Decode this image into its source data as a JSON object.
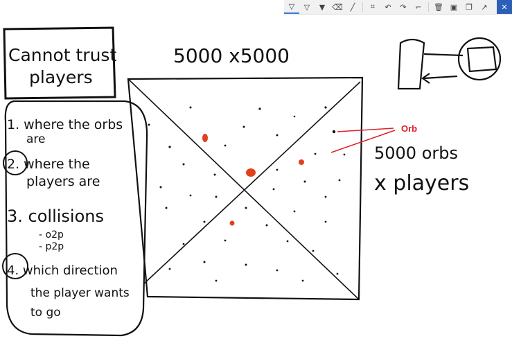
{
  "toolbar": {
    "buttons": [
      {
        "name": "pen-black-icon",
        "glyph": "▽"
      },
      {
        "name": "pen-dark-icon",
        "glyph": "▽"
      },
      {
        "name": "pen-blue-icon",
        "glyph": "▼"
      },
      {
        "name": "eraser-icon",
        "glyph": "⌫"
      },
      {
        "name": "ruler-icon",
        "glyph": "╱"
      },
      {
        "name": "lasso-icon",
        "glyph": "⌗"
      },
      {
        "name": "undo-icon",
        "glyph": "↶"
      },
      {
        "name": "redo-icon",
        "glyph": "↷"
      },
      {
        "name": "crop-icon",
        "glyph": "⌐"
      },
      {
        "name": "delete-icon",
        "glyph": "🗑"
      },
      {
        "name": "save-icon",
        "glyph": "▣"
      },
      {
        "name": "copy-icon",
        "glyph": "❐"
      },
      {
        "name": "share-icon",
        "glyph": "↗"
      },
      {
        "name": "close-icon",
        "glyph": "✕"
      }
    ]
  },
  "box_title": {
    "line1": "Cannot trust",
    "line2": "players"
  },
  "list": {
    "item1": {
      "line1": "1. where  the orbs",
      "line2": "are"
    },
    "item2": {
      "line1": "2. where  the",
      "line2": "players are"
    },
    "item3": {
      "line1": "3.  collisions",
      "line2": "- o2p",
      "line3": "- p2p"
    },
    "item4": {
      "line1": "4. which direction",
      "line2": "the player wants",
      "line3": "to go"
    }
  },
  "map_size": "5000 x5000",
  "orb_label": "Orb",
  "orbs_note": {
    "line1": "5000  orbs",
    "line2": "x  players"
  },
  "colors": {
    "ink": "#111111",
    "player": "#e2401c",
    "annotation": "#e0202a",
    "toolbar_accent": "#2b5fb8"
  }
}
